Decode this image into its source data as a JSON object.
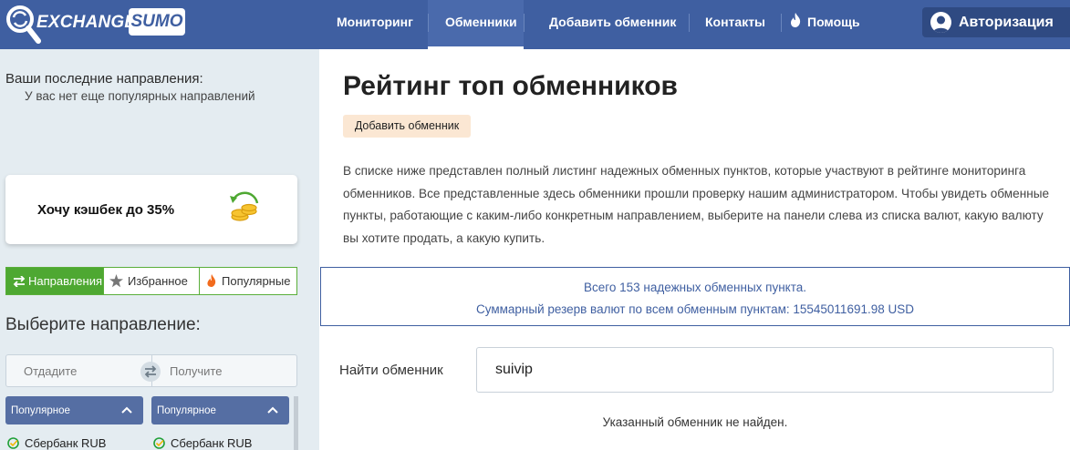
{
  "header": {
    "logo_text": "EXCHANGE",
    "logo_badge": "SUMO",
    "nav": [
      {
        "label": "Мониторинг"
      },
      {
        "label": "Обменники"
      },
      {
        "label": "Добавить обменник"
      },
      {
        "label": "Контакты"
      },
      {
        "label": "Помощь"
      }
    ],
    "active_nav": "Обменники",
    "auth_label": "Авторизация"
  },
  "sidebar": {
    "recent_title": "Ваши последние направления:",
    "recent_empty": "У вас нет еще популярных направлений",
    "cashback_label": "Хочу кэшбек до 35%",
    "tabs": [
      {
        "label": "Направления"
      },
      {
        "label": "Избранное"
      },
      {
        "label": "Популярные"
      }
    ],
    "choose_title": "Выберите направление:",
    "give_label": "Отдадите",
    "get_label": "Получите",
    "left_list": {
      "header": "Популярное",
      "items": [
        "Сбербанк RUB"
      ]
    },
    "right_list": {
      "header": "Популярное",
      "items": [
        "Сбербанк RUB"
      ]
    }
  },
  "main": {
    "title": "Рейтинг топ обменников",
    "add_button": "Добавить обменник",
    "description": "В списке ниже представлен полный листинг надежных обменных пунктов, которые участвуют в рейтинге мониторинга обменников. Все представленные здесь обменники прошли проверку нашим администратором. Чтобы увидеть обменные пункты, работающие с каким-либо конкретным направлением, выберите на панели слева из списка валют, какую валюту вы хотите продать, а какую купить.",
    "stats_total": "Всего 153 надежных обменных пункта.",
    "stats_reserve": "Суммарный резерв валют по всем обменным пунктам: 15545011691.98 USD",
    "search_label": "Найти обменник",
    "search_value": "suivip",
    "not_found": "Указанный обменник не найден."
  },
  "colors": {
    "header_bg": "#3f5fa1",
    "sidebar_bg": "#e4ecf1",
    "accent_green": "#4ea832",
    "add_button_bg": "#fbe7d3",
    "popular_bg": "#556ea3"
  }
}
